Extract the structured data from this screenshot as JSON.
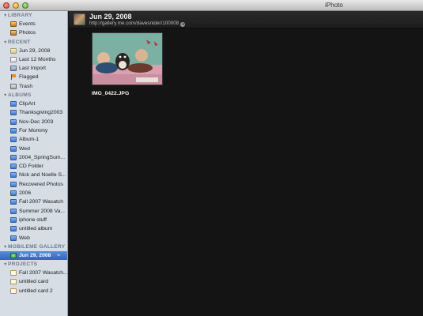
{
  "window": {
    "title": "iPhoto"
  },
  "sidebar": {
    "sections": [
      {
        "key": "library",
        "label": "LIBRARY",
        "items": [
          {
            "label": "Events",
            "icon": "events-icon"
          },
          {
            "label": "Photos",
            "icon": "photos-icon"
          }
        ]
      },
      {
        "key": "recent",
        "label": "RECENT",
        "items": [
          {
            "label": "Jun 29, 2008",
            "icon": "recent-event-icon"
          },
          {
            "label": "Last 12 Months",
            "icon": "calendar-icon"
          },
          {
            "label": "Last Import",
            "icon": "import-icon"
          },
          {
            "label": "Flagged",
            "icon": "flag-icon"
          },
          {
            "label": "Trash",
            "icon": "trash-icon"
          }
        ]
      },
      {
        "key": "albums",
        "label": "ALBUMS",
        "items": [
          {
            "label": "ClipArt"
          },
          {
            "label": "Thanksgiving2003"
          },
          {
            "label": "Nov-Dec 2003"
          },
          {
            "label": "For Mommy"
          },
          {
            "label": "Album-1"
          },
          {
            "label": "Wed"
          },
          {
            "label": "2004_SpringSum..."
          },
          {
            "label": "CD Folder"
          },
          {
            "label": "Nick and Noelle S..."
          },
          {
            "label": "Recovered Photos"
          },
          {
            "label": "2006"
          },
          {
            "label": "Fall 2007 Wasatch"
          },
          {
            "label": "Summer 2008 Va..."
          },
          {
            "label": "iphone stuff"
          },
          {
            "label": "untitled album"
          },
          {
            "label": "Web"
          }
        ]
      },
      {
        "key": "mobileme",
        "label": "MOBILEME GALLERY",
        "items": [
          {
            "label": "Jun 29, 2008",
            "icon": "gallery-icon",
            "selected": true
          }
        ]
      },
      {
        "key": "projects",
        "label": "PROJECTS",
        "items": [
          {
            "label": "Fall 2007 Wasatch..."
          },
          {
            "label": "untitled card"
          },
          {
            "label": "untitled card 2"
          }
        ]
      }
    ]
  },
  "main": {
    "gallery_title": "Jun 29, 2008",
    "gallery_url": "http://gallery.me.com/davesnider/100008",
    "photo": {
      "caption": "IMG_0422.JPG"
    }
  },
  "colors": {
    "sidebar_bg": "#d6dde5",
    "selection": "#3f74c8",
    "main_bg": "#141414"
  }
}
